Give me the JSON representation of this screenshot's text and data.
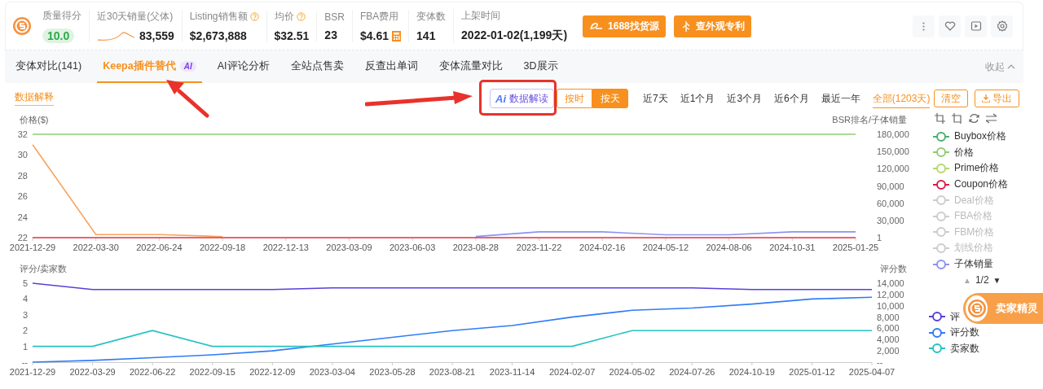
{
  "header": {
    "stats": [
      {
        "kind": "score",
        "label": "质量得分",
        "value": "10.0"
      },
      {
        "kind": "sparkline",
        "label": "近30天销量(父体)",
        "value": "83,559"
      },
      {
        "kind": "help",
        "label": "Listing销售额",
        "value": "$2,673,888"
      },
      {
        "kind": "help",
        "label": "均价",
        "value": "$32.51"
      },
      {
        "kind": "plain",
        "label": "BSR",
        "value": "23"
      },
      {
        "kind": "calculator",
        "label": "FBA费用",
        "value": "$4.61"
      },
      {
        "kind": "plain",
        "label": "变体数",
        "value": "141"
      },
      {
        "kind": "plain",
        "label": "上架时间",
        "value": "2022-01-02(1,199天)"
      }
    ],
    "buttons": [
      {
        "kind": "source",
        "label": "1688找货源"
      },
      {
        "kind": "patent",
        "label": "查外观专利"
      }
    ],
    "icons": [
      {
        "kind": "more"
      },
      {
        "kind": "heart"
      },
      {
        "kind": "play"
      },
      {
        "kind": "settings"
      }
    ]
  },
  "tabs": [
    {
      "label": "变体对比(141)",
      "selected": false
    },
    {
      "label": "Keepa插件替代",
      "selected": true,
      "badge": "AI"
    },
    {
      "label": "AI评论分析",
      "selected": false
    },
    {
      "label": "全站点售卖",
      "selected": false
    },
    {
      "label": "反查出单词",
      "selected": false
    },
    {
      "label": "变体流量对比",
      "selected": false
    },
    {
      "label": "3D展示",
      "selected": false
    }
  ],
  "collapse": "收起",
  "toolbar": {
    "explain": "数据解释",
    "ai_button": {
      "icon_text": "Ai",
      "label": "数据解读"
    },
    "granularity": [
      {
        "label": "按时",
        "selected": false
      },
      {
        "label": "按天",
        "selected": true
      }
    ],
    "ranges": [
      {
        "label": "近7天",
        "selected": false
      },
      {
        "label": "近1个月",
        "selected": false
      },
      {
        "label": "近3个月",
        "selected": false
      },
      {
        "label": "近6个月",
        "selected": false
      },
      {
        "label": "最近一年",
        "selected": false
      },
      {
        "label": "全部(1203天)",
        "selected": true
      }
    ],
    "clear": "清空",
    "export": "导出"
  },
  "price_chart": {
    "chart_data": {
      "type": "line",
      "ylabel": "价格($)",
      "y2label": "BSR排名/子体销量",
      "categories": [
        "2021-12-29",
        "2022-03-30",
        "2022-06-24",
        "2022-09-18",
        "2022-12-13",
        "2023-03-09",
        "2023-06-03",
        "2023-08-28",
        "2023-11-22",
        "2024-02-16",
        "2024-05-12",
        "2024-08-06",
        "2024-10-31",
        "2025-01-25"
      ],
      "ylim": [
        22,
        32
      ],
      "yticks": [
        22,
        24,
        26,
        28,
        30,
        32
      ],
      "y2lim": [
        1,
        180000
      ],
      "y2ticks": [
        1,
        {
          "value": 30000,
          "label": "30,000"
        },
        {
          "value": 60000,
          "label": "60,000"
        },
        {
          "value": 90000,
          "label": "90,000"
        },
        {
          "value": 120000,
          "label": "120,000"
        },
        {
          "value": 150000,
          "label": "150,000"
        },
        {
          "value": 180000,
          "label": "180,000"
        }
      ],
      "series": [
        {
          "color": "#91cc75",
          "values": [
            32,
            32,
            32,
            32,
            32,
            32,
            32,
            32,
            32,
            32,
            32,
            32,
            32,
            32
          ]
        },
        {
          "color": "#f7a35c",
          "values": [
            31,
            22.3,
            22.3,
            22.1,
            null,
            null,
            null,
            null,
            null,
            null,
            null,
            null,
            null,
            null
          ]
        },
        {
          "color": "#8c93f0",
          "axis": "y2",
          "values": [
            null,
            null,
            null,
            null,
            null,
            null,
            null,
            2000,
            10000,
            10000,
            5000,
            5000,
            10000,
            10000
          ]
        },
        {
          "color": "#e8394a",
          "values": [
            22,
            22,
            22,
            22,
            22,
            22,
            22,
            22,
            22,
            22,
            22,
            22,
            22,
            22
          ]
        }
      ]
    }
  },
  "price_legend": {
    "tools": [
      {
        "kind": "crop"
      },
      {
        "kind": "crop-alt"
      },
      {
        "kind": "refresh"
      },
      {
        "kind": "swap"
      }
    ],
    "items": [
      {
        "label": "Buybox价格",
        "on": true,
        "color": "#4caf6e"
      },
      {
        "label": "价格",
        "on": true,
        "color": "#91cc75"
      },
      {
        "label": "Prime价格",
        "on": true,
        "color": "#b5d86b"
      },
      {
        "label": "Coupon价格",
        "on": true,
        "color": "#d81e4a"
      },
      {
        "label": "Deal价格",
        "on": false
      },
      {
        "label": "FBA价格",
        "on": false
      },
      {
        "label": "FBM价格",
        "on": false
      },
      {
        "label": "划线价格",
        "on": false
      },
      {
        "label": "子体销量",
        "on": true,
        "color": "#8c93f0"
      }
    ],
    "pager": {
      "prev": "▲",
      "page": "1/2",
      "next": "▼",
      "prev_disabled": true
    }
  },
  "rating_chart": {
    "chart_data": {
      "type": "line",
      "ylabel": "评分/卖家数",
      "y2label": "评分数",
      "categories": [
        "2021-12-29",
        "2022-03-29",
        "2022-06-22",
        "2022-09-15",
        "2022-12-09",
        "2023-03-04",
        "2023-05-28",
        "2023-08-21",
        "2023-11-14",
        "2024-02-07",
        "2024-05-02",
        "2024-07-26",
        "2024-10-19",
        "2025-01-12",
        "2025-04-07"
      ],
      "ylim": [
        0,
        5
      ],
      "yticks": [
        {
          "value": 0,
          "label": "--"
        },
        1,
        2,
        3,
        4,
        5
      ],
      "y2lim": [
        0,
        14000
      ],
      "y2ticks": [
        {
          "value": 0,
          "label": "--"
        },
        {
          "value": 2000,
          "label": "2,000"
        },
        {
          "value": 4000,
          "label": "4,000"
        },
        {
          "value": 6000,
          "label": "6,000"
        },
        {
          "value": 8000,
          "label": "8,000"
        },
        {
          "value": 10000,
          "label": "10,000"
        },
        {
          "value": 12000,
          "label": "12,000"
        },
        {
          "value": 14000,
          "label": "14,000"
        }
      ],
      "series": [
        {
          "color": "#5b3fd9",
          "values": [
            5,
            4.6,
            4.6,
            4.6,
            4.6,
            4.7,
            4.7,
            4.7,
            4.7,
            4.7,
            4.7,
            4.7,
            4.6,
            4.6,
            4.6
          ]
        },
        {
          "color": "#2f7cf6",
          "axis": "y2",
          "values": [
            0,
            300,
            800,
            1300,
            2000,
            3200,
            4400,
            5600,
            6500,
            8000,
            9200,
            9600,
            10300,
            11200,
            11500
          ]
        },
        {
          "color": "#26c2c2",
          "values": [
            1,
            1,
            2,
            1,
            1,
            1,
            1,
            1,
            1,
            1,
            2,
            2,
            2,
            2,
            2
          ]
        }
      ]
    }
  },
  "rating_legend": {
    "items": [
      {
        "label": "评",
        "on": true,
        "color": "#5b3fd9"
      },
      {
        "label": "评分数",
        "on": true,
        "color": "#2f7cf6"
      },
      {
        "label": "卖家数",
        "on": true,
        "color": "#26c2c2"
      }
    ]
  },
  "floating_badge": {
    "label": "卖家精灵"
  },
  "annotations": [
    {
      "kind": "arrow"
    },
    {
      "kind": "arrow"
    },
    {
      "kind": "highlight"
    }
  ]
}
